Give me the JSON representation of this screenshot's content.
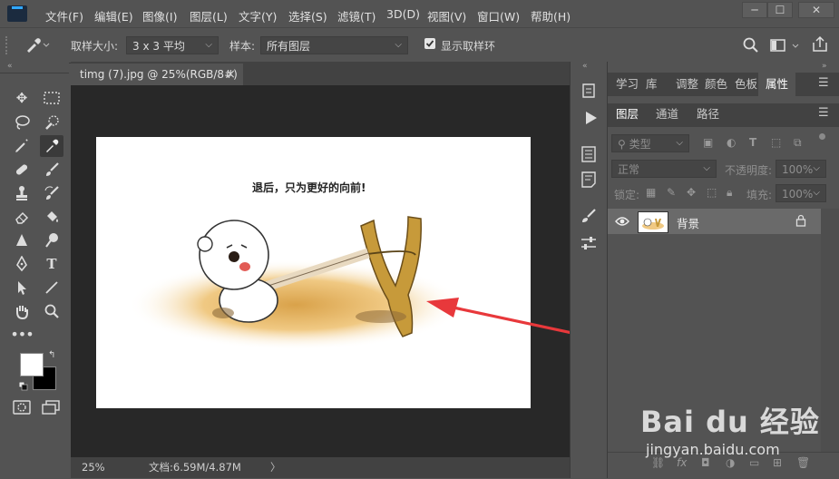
{
  "menubar": {
    "items": [
      "文件(F)",
      "编辑(E)",
      "图像(I)",
      "图层(L)",
      "文字(Y)",
      "选择(S)",
      "滤镜(T)",
      "3D(D)",
      "视图(V)",
      "窗口(W)",
      "帮助(H)"
    ],
    "window_controls": {
      "minimize": "─",
      "maximize": "☐",
      "close": "✕"
    }
  },
  "options_bar": {
    "sample_size_label": "取样大小:",
    "sample_size_value": "3 x 3 平均",
    "sample_label": "样本:",
    "sample_value": "所有图层",
    "show_ring_label": "显示取样环",
    "show_ring_checked": true
  },
  "document": {
    "tab_title": "timg (7).jpg @ 25%(RGB/8#)",
    "tab_close": "×",
    "image_caption": "退后，只为更好的向前!",
    "zoom": "25%",
    "doc_size": "文档:6.59M/4.87M",
    "status_arrow": "〉"
  },
  "panel_tabs": [
    "学习",
    "库",
    "调整",
    "颜色",
    "色板",
    "属性"
  ],
  "panel_tabs_active": "属性",
  "layers_tabs": [
    "图层",
    "通道",
    "路径"
  ],
  "layers_tabs_active": "图层",
  "layers_panel": {
    "filter_label": "类型",
    "blend_mode": "正常",
    "opacity_label": "不透明度:",
    "opacity_value": "100%",
    "lock_label": "锁定:",
    "fill_label": "填充:",
    "fill_value": "100%",
    "layers": [
      {
        "name": "背景",
        "visible": true,
        "locked": true
      }
    ]
  },
  "watermark": {
    "line1": "Bai du 经验",
    "line2": "jingyan.baidu.com"
  },
  "colors": {
    "app_bg": "#535353",
    "canvas_bg": "#282828",
    "accent_blue": "#31a8ff",
    "arrow_red": "#e8383b"
  }
}
